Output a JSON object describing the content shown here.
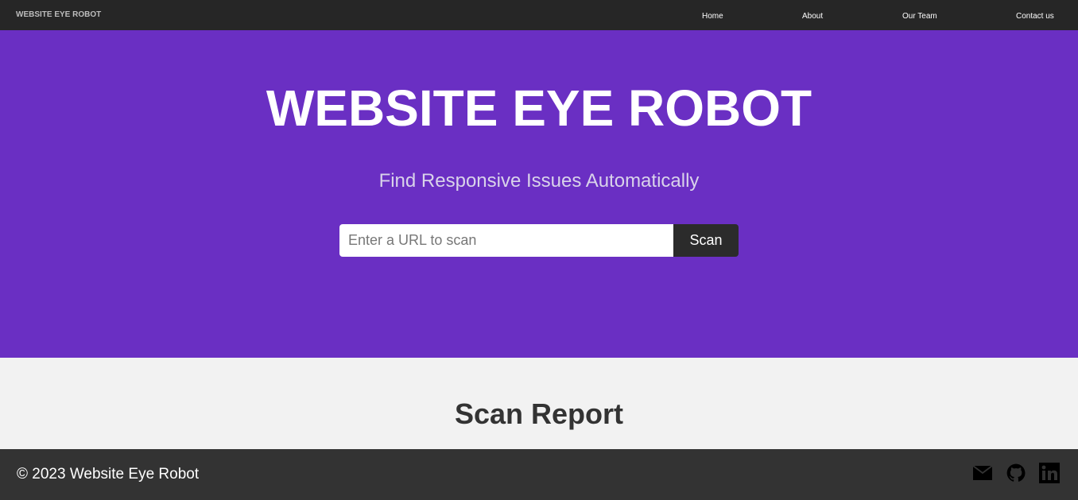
{
  "nav": {
    "brand": "WEBSITE EYE ROBOT",
    "links": [
      "Home",
      "About",
      "Our Team",
      "Contact us"
    ]
  },
  "hero": {
    "title": "WEBSITE EYE ROBOT",
    "subtitle": "Find Responsive Issues Automatically",
    "input_placeholder": "Enter a URL to scan",
    "input_value": "",
    "scan_label": "Scan"
  },
  "report": {
    "title": "Scan Report"
  },
  "footer": {
    "copyright": "© 2023 Website Eye Robot",
    "social_icons": [
      "mail-icon",
      "github-icon",
      "linkedin-icon"
    ]
  },
  "colors": {
    "nav_bg": "#262626",
    "hero_bg": "#6a2fc3",
    "button_bg": "#2b2b2b",
    "page_bg": "#f2f2f2",
    "footer_bg": "#333333"
  }
}
